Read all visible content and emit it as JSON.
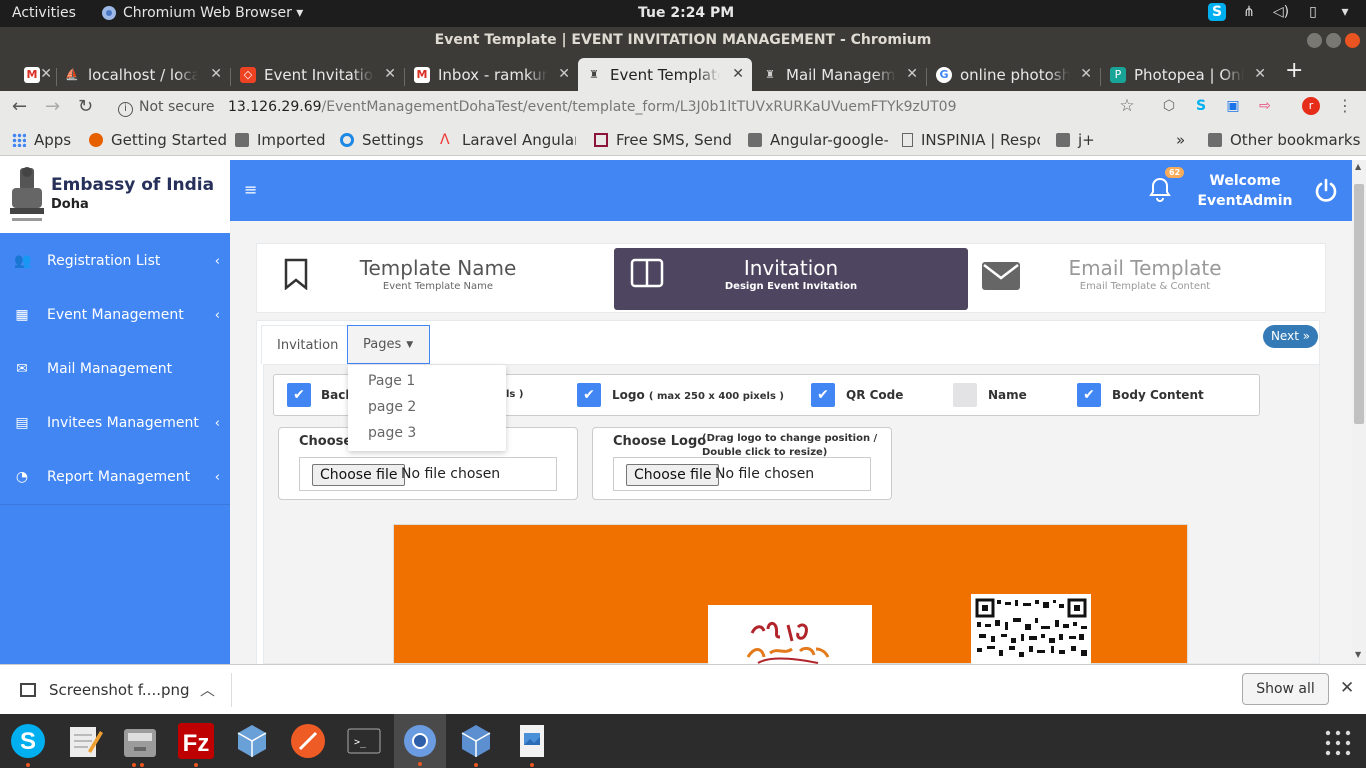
{
  "gnome": {
    "activities": "Activities",
    "app_menu": "Chromium Web Browser ▾",
    "clock": "Tue  2:24 PM"
  },
  "window": {
    "title": "Event Template | EVENT INVITATION MANAGEMENT - Chromium"
  },
  "tabs": [
    {
      "label": "",
      "icon": "gmail-icon"
    },
    {
      "label": "localhost / localhost",
      "icon": "phpmyadmin-icon"
    },
    {
      "label": "Event Invitation",
      "icon": "codeigniter-icon"
    },
    {
      "label": "Inbox - ramkumar",
      "icon": "gmail-icon"
    },
    {
      "label": "Event Template",
      "icon": "emblem-icon",
      "active": true
    },
    {
      "label": "Mail Management",
      "icon": "emblem-icon"
    },
    {
      "label": "online photoshop",
      "icon": "google-icon"
    },
    {
      "label": "Photopea | Online",
      "icon": "photopea-icon"
    }
  ],
  "toolbar": {
    "secure": "Not secure",
    "url_host": "13.126.29.69",
    "url_path": "/EventManagementDohaTest/event/template_form/L3J0b1ltTUVxRURKaUVuemFTYk9zUT09",
    "profile_initial": "r"
  },
  "bookmarks": {
    "items": [
      "Apps",
      "Getting Started",
      "Imported",
      "Settings",
      "Laravel Angular",
      "Free SMS, Send F",
      "Angular-google-",
      "INSPINIA | Respo",
      "j+"
    ],
    "overflow": "»",
    "other": "Other bookmarks"
  },
  "sidebar": {
    "brand_title": "Embassy of India",
    "brand_sub": "Doha",
    "items": [
      {
        "label": "Registration List",
        "chevron": "‹"
      },
      {
        "label": "Event Management",
        "chevron": "‹"
      },
      {
        "label": "Mail Management",
        "chevron": ""
      },
      {
        "label": "Invitees Management",
        "chevron": "‹"
      },
      {
        "label": "Report Management",
        "chevron": "‹"
      }
    ]
  },
  "header": {
    "burger": "≡",
    "badge": "62",
    "welcome_line1": "Welcome",
    "welcome_line2": "EventAdmin"
  },
  "wizard": {
    "steps": [
      {
        "title": "Template Name",
        "subtitle": "Event Template Name"
      },
      {
        "title": "Invitation",
        "subtitle": "Design Event Invitation"
      },
      {
        "title": "Email Template",
        "subtitle": "Email Template & Content"
      }
    ]
  },
  "panel": {
    "tab_invitation": "Invitation",
    "tab_pages": "Pages",
    "next": "Next »",
    "dropdown": [
      "Page 1",
      "page 2",
      "page 3"
    ],
    "checks": {
      "back_label": "Back",
      "back_tail": "ls )",
      "logo_label": "Logo",
      "logo_hint": "( max 250 x 400 pixels )",
      "qr_label": "QR Code",
      "name_label": "Name",
      "body_label": "Body Content"
    },
    "file1": {
      "label": "Choose",
      "button": "Choose file",
      "status": "No file chosen"
    },
    "file2": {
      "label": "Choose Logo",
      "hint": "(Drag logo to change position / Double click to resize)",
      "button": "Choose file",
      "status": "No file chosen"
    }
  },
  "download_bar": {
    "file": "Screenshot f....png",
    "show_all": "Show all"
  },
  "colors": {
    "primary": "#4286f4",
    "active_step": "#4e4660",
    "canvas": "#f07000",
    "next_btn": "#337ab7"
  }
}
